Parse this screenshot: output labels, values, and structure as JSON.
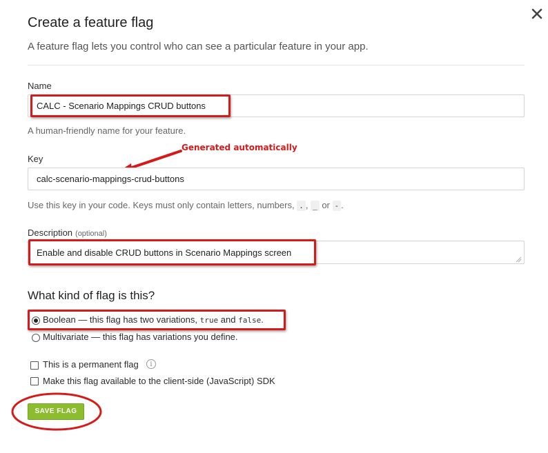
{
  "dialog": {
    "title": "Create a feature flag",
    "subtitle": "A feature flag lets you control who can see a particular feature in your app."
  },
  "name_field": {
    "label": "Name",
    "value": "CALC - Scenario Mappings CRUD buttons",
    "help": "A human-friendly name for your feature."
  },
  "key_field": {
    "label": "Key",
    "value": "calc-scenario-mappings-crud-buttons",
    "help_prefix": "Use this key in your code. Keys must only contain letters, numbers,",
    "help_code_1": ".",
    "help_sep": ",",
    "help_code_2": "_",
    "help_or": "or",
    "help_code_3": "-",
    "help_end": "."
  },
  "description_field": {
    "label": "Description",
    "optional": "(optional)",
    "value": "Enable and disable CRUD buttons in Scenario Mappings screen"
  },
  "flag_kind": {
    "title": "What kind of flag is this?",
    "boolean_prefix": "Boolean — this flag has two variations,",
    "boolean_true": "true",
    "boolean_and": "and",
    "boolean_false": "false",
    "boolean_end": ".",
    "multivariate": "Multivariate — this flag has variations you define.",
    "selected": "boolean"
  },
  "options": {
    "permanent": "This is a permanent flag",
    "client_side": "Make this flag available to the client-side (JavaScript) SDK"
  },
  "save_button": {
    "label": "SAVE FLAG"
  },
  "annotation": {
    "text": "Generated automatically"
  },
  "colors": {
    "accent_green": "#8cbd2e",
    "annotation_red": "#d61a1a"
  },
  "icons": {
    "close": "close-icon",
    "info": "info-icon"
  }
}
